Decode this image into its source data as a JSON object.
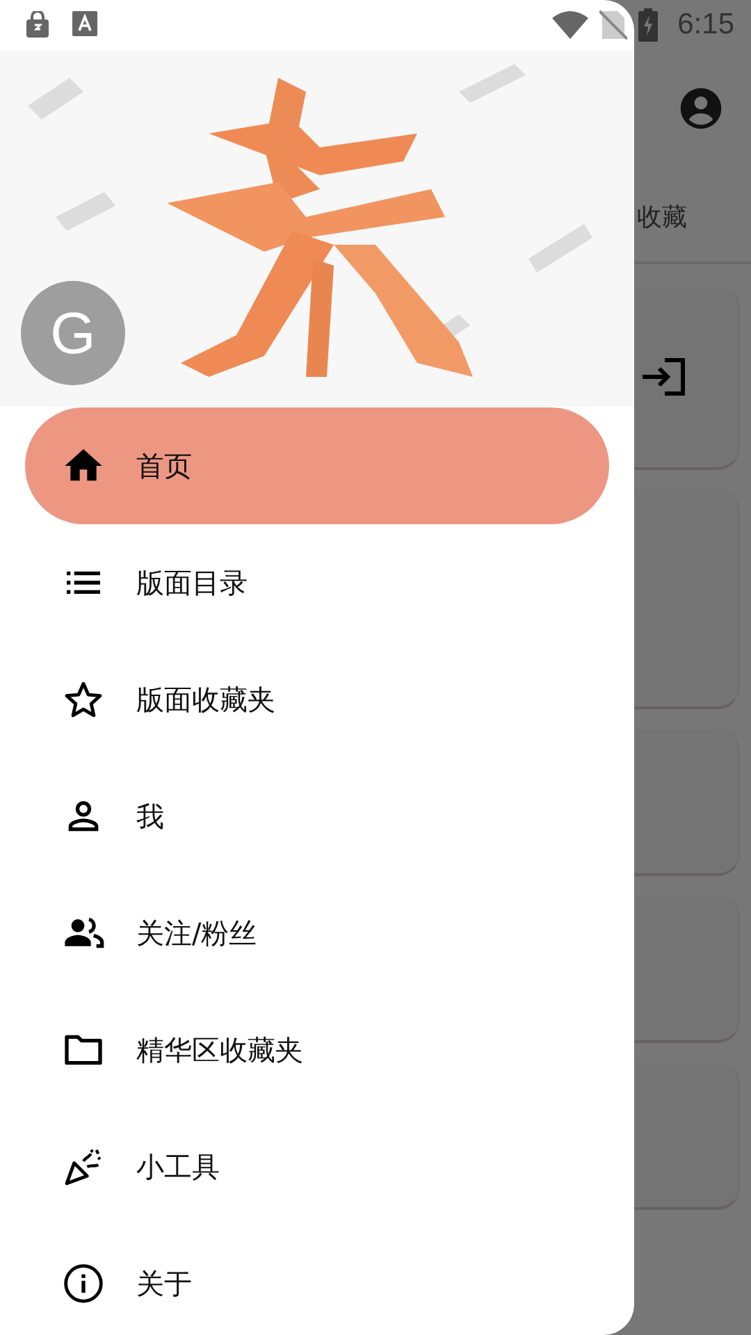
{
  "status_bar": {
    "time": "6:15"
  },
  "background_app": {
    "tab_label": "收藏"
  },
  "drawer": {
    "avatar_letter": "G",
    "items": [
      {
        "label": "首页",
        "selected": true
      },
      {
        "label": "版面目录",
        "selected": false
      },
      {
        "label": "版面收藏夹",
        "selected": false
      },
      {
        "label": "我",
        "selected": false
      },
      {
        "label": "关注/粉丝",
        "selected": false
      },
      {
        "label": "精华区收藏夹",
        "selected": false
      },
      {
        "label": "小工具",
        "selected": false
      },
      {
        "label": "关于",
        "selected": false
      }
    ]
  }
}
